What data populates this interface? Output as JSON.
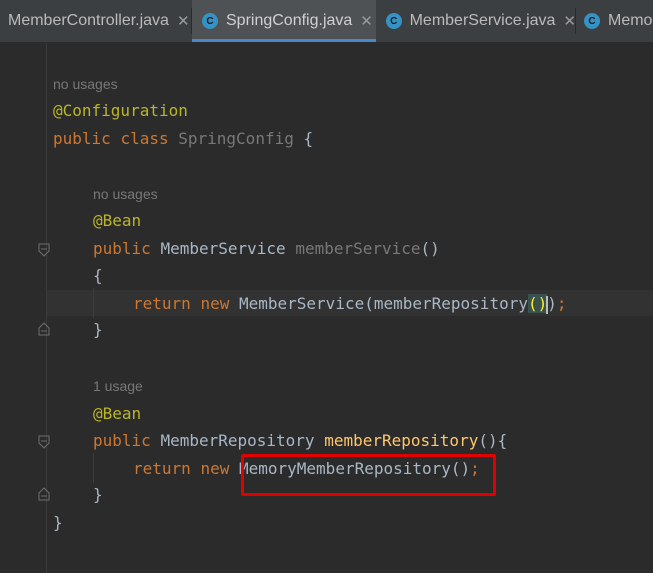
{
  "tabs": [
    {
      "label": "MemberController.java",
      "active": false
    },
    {
      "label": "SpringConfig.java",
      "active": true
    },
    {
      "label": "MemberService.java",
      "active": false
    },
    {
      "label": "Memor",
      "active": false
    }
  ],
  "tab_icon": "C",
  "tab_close_glyph": "✕",
  "code": {
    "hint_no_usages_1": "no usages",
    "annotation_configuration": "@Configuration",
    "kw_public": "public",
    "kw_class": "class",
    "class_name": "SpringConfig",
    "open_brace": "{",
    "hint_no_usages_2": "no usages",
    "annotation_bean_1": "@Bean",
    "type_member_service": "MemberService",
    "method_member_service": "memberService",
    "parens": "()",
    "kw_return": "return",
    "kw_new": "new",
    "ctor_member_service": "MemberService(memberRepository",
    "hl_parens": "()",
    "close_paren": ")",
    "semicolon": ";",
    "close_brace": "}",
    "hint_1_usage": "1 usage",
    "annotation_bean_2": "@Bean",
    "type_member_repository": "MemberRepository",
    "method_member_repository": "memberRepository",
    "parens_brace": "(){",
    "ctor_memory_repo": "MemoryMemberRepository();",
    "ctor_memory_repo_semi": ";"
  },
  "colors": {
    "background": "#2b2b2b",
    "keyword": "#cc7832",
    "annotation": "#bbb529",
    "method_decl": "#ffc66d",
    "highlight_box": "#e00000",
    "tab_underline": "#4a88c7"
  }
}
